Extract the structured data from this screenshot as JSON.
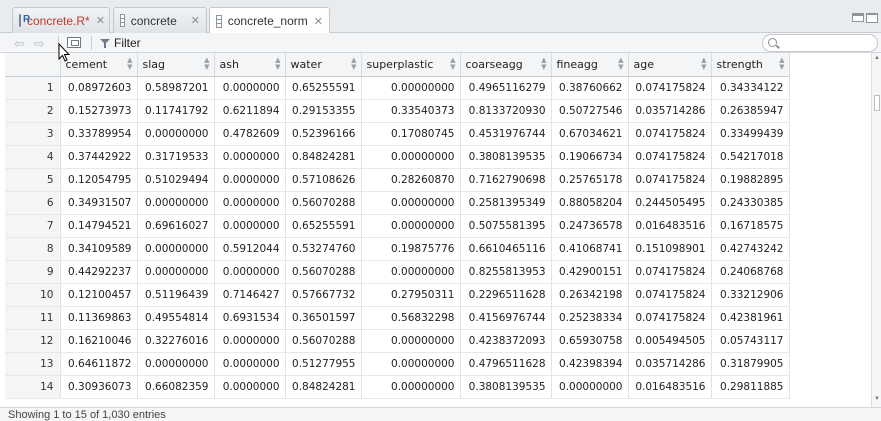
{
  "tabs": [
    {
      "label": "concrete.R*",
      "icon": "r-script-icon",
      "modified": true,
      "active": false
    },
    {
      "label": "concrete",
      "icon": "data-grid-icon",
      "modified": false,
      "active": false
    },
    {
      "label": "concrete_norm",
      "icon": "data-grid-icon",
      "modified": false,
      "active": true
    }
  ],
  "toolbar": {
    "filter_label": "Filter",
    "search_placeholder": "",
    "search_value": ""
  },
  "table": {
    "columns": [
      "cement",
      "slag",
      "ash",
      "water",
      "superplastic",
      "coarseagg",
      "fineagg",
      "age",
      "strength"
    ],
    "rows": [
      {
        "n": "1",
        "cells": [
          "0.08972603",
          "0.58987201",
          "0.0000000",
          "0.65255591",
          "0.00000000",
          "0.4965116279",
          "0.38760662",
          "0.074175824",
          "0.34334122"
        ]
      },
      {
        "n": "2",
        "cells": [
          "0.15273973",
          "0.11741792",
          "0.6211894",
          "0.29153355",
          "0.33540373",
          "0.8133720930",
          "0.50727546",
          "0.035714286",
          "0.26385947"
        ]
      },
      {
        "n": "3",
        "cells": [
          "0.33789954",
          "0.00000000",
          "0.4782609",
          "0.52396166",
          "0.17080745",
          "0.4531976744",
          "0.67034621",
          "0.074175824",
          "0.33499439"
        ]
      },
      {
        "n": "4",
        "cells": [
          "0.37442922",
          "0.31719533",
          "0.0000000",
          "0.84824281",
          "0.00000000",
          "0.3808139535",
          "0.19066734",
          "0.074175824",
          "0.54217018"
        ]
      },
      {
        "n": "5",
        "cells": [
          "0.12054795",
          "0.51029494",
          "0.0000000",
          "0.57108626",
          "0.28260870",
          "0.7162790698",
          "0.25765178",
          "0.074175824",
          "0.19882895"
        ]
      },
      {
        "n": "6",
        "cells": [
          "0.34931507",
          "0.00000000",
          "0.0000000",
          "0.56070288",
          "0.00000000",
          "0.2581395349",
          "0.88058204",
          "0.244505495",
          "0.24330385"
        ]
      },
      {
        "n": "7",
        "cells": [
          "0.14794521",
          "0.69616027",
          "0.0000000",
          "0.65255591",
          "0.00000000",
          "0.5075581395",
          "0.24736578",
          "0.016483516",
          "0.16718575"
        ]
      },
      {
        "n": "8",
        "cells": [
          "0.34109589",
          "0.00000000",
          "0.5912044",
          "0.53274760",
          "0.19875776",
          "0.6610465116",
          "0.41068741",
          "0.151098901",
          "0.42743242"
        ]
      },
      {
        "n": "9",
        "cells": [
          "0.44292237",
          "0.00000000",
          "0.0000000",
          "0.56070288",
          "0.00000000",
          "0.8255813953",
          "0.42900151",
          "0.074175824",
          "0.24068768"
        ]
      },
      {
        "n": "10",
        "cells": [
          "0.12100457",
          "0.51196439",
          "0.7146427",
          "0.57667732",
          "0.27950311",
          "0.2296511628",
          "0.26342198",
          "0.074175824",
          "0.33212906"
        ]
      },
      {
        "n": "11",
        "cells": [
          "0.11369863",
          "0.49554814",
          "0.6931534",
          "0.36501597",
          "0.56832298",
          "0.4156976744",
          "0.25238334",
          "0.074175824",
          "0.42381961"
        ]
      },
      {
        "n": "12",
        "cells": [
          "0.16210046",
          "0.32276016",
          "0.0000000",
          "0.56070288",
          "0.00000000",
          "0.4238372093",
          "0.65930758",
          "0.005494505",
          "0.05743117"
        ]
      },
      {
        "n": "13",
        "cells": [
          "0.64611872",
          "0.00000000",
          "0.0000000",
          "0.51277955",
          "0.00000000",
          "0.4796511628",
          "0.42398394",
          "0.035714286",
          "0.31879905"
        ]
      },
      {
        "n": "14",
        "cells": [
          "0.30936073",
          "0.66082359",
          "0.0000000",
          "0.84824281",
          "0.00000000",
          "0.3808139535",
          "0.00000000",
          "0.016483516",
          "0.29811885"
        ]
      }
    ]
  },
  "status": {
    "text": "Showing 1 to 15 of 1,030 entries"
  },
  "colors": {
    "modified_tab_text": "#c0392b",
    "header_bg": "#f3f5f7",
    "grid_line": "#e1e3e5"
  }
}
